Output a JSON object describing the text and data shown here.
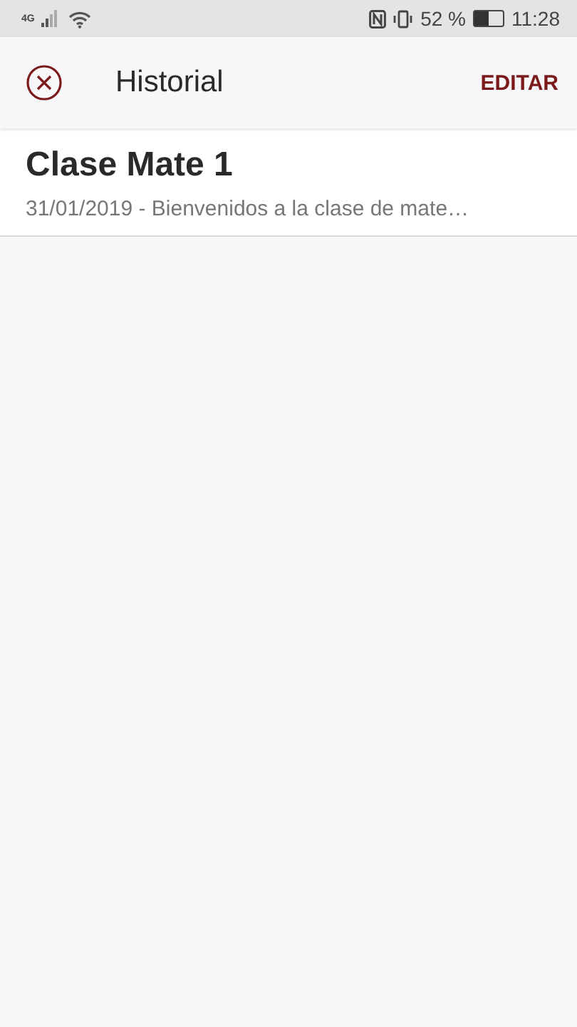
{
  "status_bar": {
    "network": "4G",
    "battery_text": "52 %",
    "time": "11:28"
  },
  "app_bar": {
    "title": "Historial",
    "action": "EDITAR"
  },
  "items": [
    {
      "title": "Clase Mate 1",
      "subtitle": "31/01/2019 - Bienvenidos a la clase de mate…"
    }
  ]
}
